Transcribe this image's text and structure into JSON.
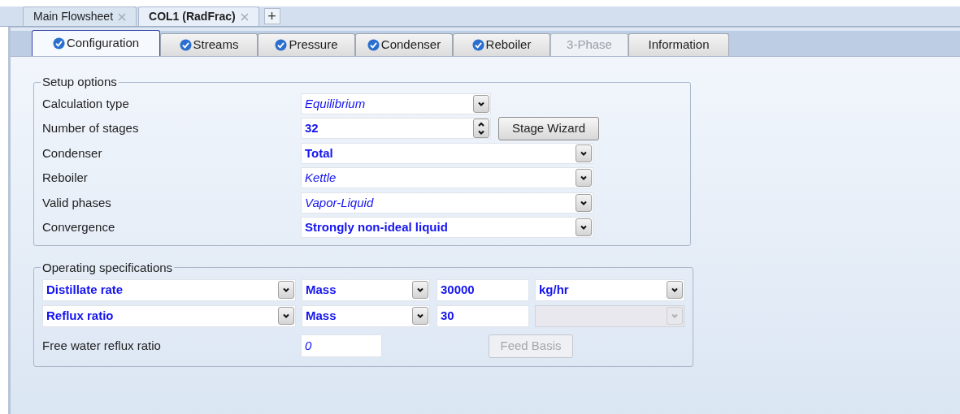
{
  "document_tabs": [
    {
      "label": "Main Flowsheet",
      "selected": false
    },
    {
      "label": "COL1 (RadFrac)",
      "selected": true
    }
  ],
  "new_tab_button": "+",
  "form_tabs": [
    {
      "label": "Configuration",
      "selected": true,
      "complete": true,
      "disabled": false
    },
    {
      "label": "Streams",
      "selected": false,
      "complete": true,
      "disabled": false
    },
    {
      "label": "Pressure",
      "selected": false,
      "complete": true,
      "disabled": false
    },
    {
      "label": "Condenser",
      "selected": false,
      "complete": true,
      "disabled": false
    },
    {
      "label": "Reboiler",
      "selected": false,
      "complete": true,
      "disabled": false
    },
    {
      "label": "3-Phase",
      "selected": false,
      "complete": false,
      "disabled": true
    },
    {
      "label": "Information",
      "selected": false,
      "complete": false,
      "disabled": false
    }
  ],
  "setup_options": {
    "title": "Setup options",
    "rows": [
      {
        "label": "Calculation type",
        "kind": "dropdown",
        "value": "Equilibrium",
        "entered": false,
        "wide": false
      },
      {
        "label": "Number of stages",
        "kind": "spinner",
        "value": "32",
        "entered": true,
        "wide": false,
        "button": "Stage Wizard"
      },
      {
        "label": "Condenser",
        "kind": "dropdown",
        "value": "Total",
        "entered": true,
        "wide": true
      },
      {
        "label": "Reboiler",
        "kind": "dropdown",
        "value": "Kettle",
        "entered": false,
        "wide": true
      },
      {
        "label": "Valid phases",
        "kind": "dropdown",
        "value": "Vapor-Liquid",
        "entered": false,
        "wide": true
      },
      {
        "label": "Convergence",
        "kind": "dropdown",
        "value": "Strongly non-ideal liquid",
        "entered": true,
        "wide": true
      }
    ]
  },
  "operating_specifications": {
    "title": "Operating specifications",
    "rows": [
      [
        {
          "kind": "dropdown",
          "value": "Distillate rate",
          "entered": true,
          "disabled": false
        },
        {
          "kind": "dropdown",
          "value": "Mass",
          "entered": true,
          "disabled": false
        },
        {
          "kind": "text",
          "value": "30000",
          "entered": true,
          "disabled": false
        },
        {
          "kind": "dropdown",
          "value": "kg/hr",
          "entered": true,
          "disabled": false
        }
      ],
      [
        {
          "kind": "dropdown",
          "value": "Reflux ratio",
          "entered": true,
          "disabled": false
        },
        {
          "kind": "dropdown",
          "value": "Mass",
          "entered": true,
          "disabled": false
        },
        {
          "kind": "text",
          "value": "30",
          "entered": true,
          "disabled": false
        },
        {
          "kind": "dropdown",
          "disabled": true
        }
      ]
    ],
    "free_water": {
      "label": "Free water reflux ratio",
      "value": "0",
      "entered": false
    },
    "feed_basis_button": {
      "label": "Feed Basis",
      "disabled": true
    }
  }
}
